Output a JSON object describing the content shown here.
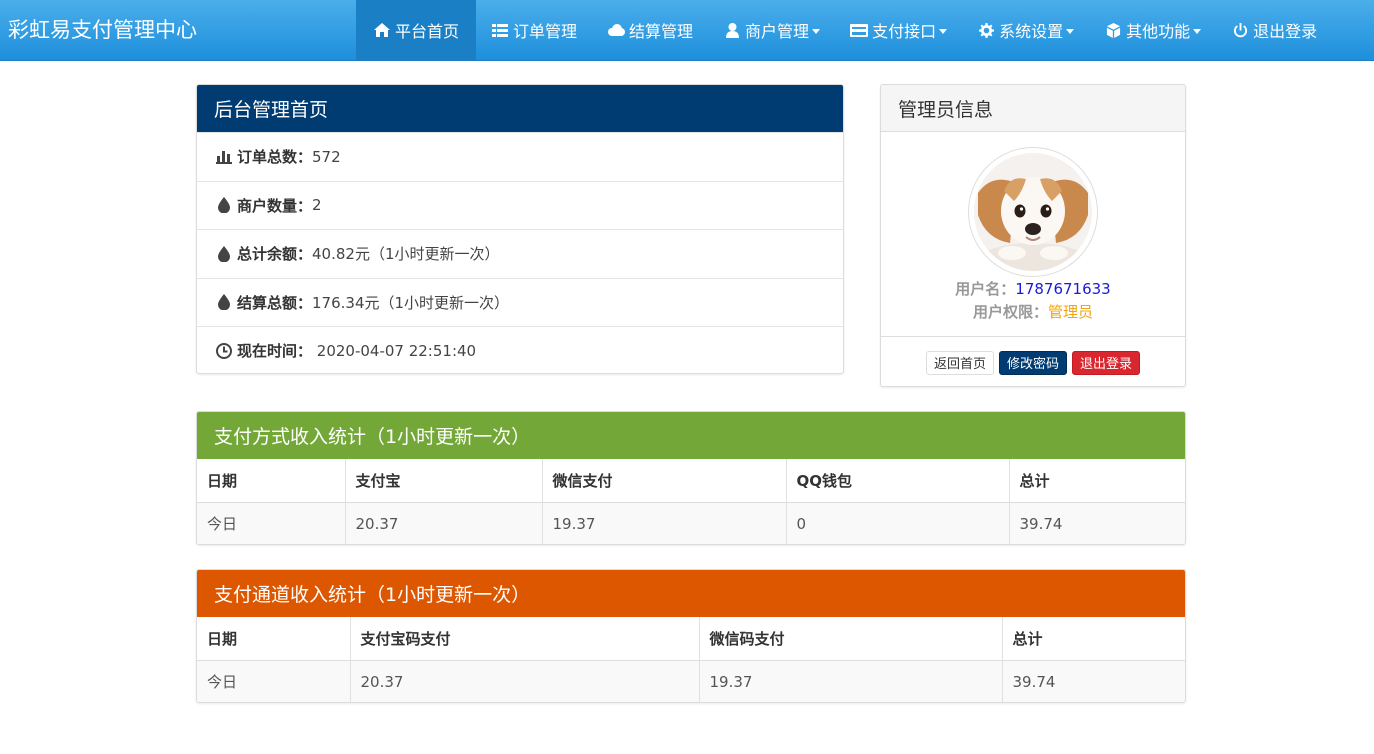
{
  "navbar": {
    "brand": "彩虹易支付管理中心",
    "items": [
      {
        "label": "平台首页",
        "icon": "home-icon",
        "active": true
      },
      {
        "label": "订单管理",
        "icon": "list-icon"
      },
      {
        "label": "结算管理",
        "icon": "cloud-icon"
      },
      {
        "label": "商户管理",
        "icon": "user-icon",
        "dropdown": true
      },
      {
        "label": "支付接口",
        "icon": "credit-card-icon",
        "dropdown": true
      },
      {
        "label": "系统设置",
        "icon": "gear-icon",
        "dropdown": true
      },
      {
        "label": "其他功能",
        "icon": "cube-icon",
        "dropdown": true
      },
      {
        "label": "退出登录",
        "icon": "power-icon"
      }
    ]
  },
  "overview": {
    "title": "后台管理首页",
    "rows": [
      {
        "icon": "bar-chart-icon",
        "label": "订单总数：",
        "value": "572"
      },
      {
        "icon": "drop-icon",
        "label": "商户数量：",
        "value": "2"
      },
      {
        "icon": "drop-icon",
        "label": "总计余额：",
        "value": "40.82元（1小时更新一次）"
      },
      {
        "icon": "drop-icon",
        "label": "结算总额：",
        "value": "176.34元（1小时更新一次）"
      },
      {
        "icon": "clock-icon",
        "label": "现在时间：",
        "value": " 2020-04-07 22:51:40"
      }
    ]
  },
  "admin": {
    "title": "管理员信息",
    "username_label": "用户名：",
    "username": "1787671633",
    "role_label": "用户权限：",
    "role": "管理员",
    "buttons": {
      "home": "返回首页",
      "change_password": "修改密码",
      "logout": "退出登录"
    }
  },
  "pay_type_stats": {
    "title": "支付方式收入统计（1小时更新一次）",
    "headers": [
      "日期",
      "支付宝",
      "微信支付",
      "QQ钱包",
      "总计"
    ],
    "rows": [
      [
        "今日",
        "20.37",
        "19.37",
        "0",
        "39.74"
      ]
    ]
  },
  "channel_stats": {
    "title": "支付通道收入统计（1小时更新一次）",
    "headers": [
      "日期",
      "支付宝码支付",
      "微信码支付",
      "总计"
    ],
    "rows": [
      [
        "今日",
        "20.37",
        "19.37",
        "39.74"
      ]
    ]
  },
  "colors": {
    "navbar": "#2a9ae6",
    "main_panel": "#003b72",
    "pay_type_panel": "#73a839",
    "channel_panel": "#dd5600"
  }
}
